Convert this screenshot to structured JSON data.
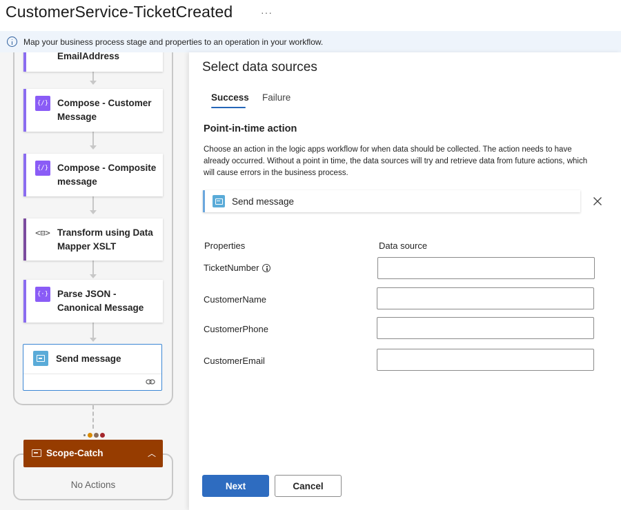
{
  "header": {
    "title": "CustomerService-TicketCreated",
    "more": "···"
  },
  "infobar": {
    "text": "Map your business process stage and properties to an operation in your workflow."
  },
  "canvas": {
    "nodes": [
      {
        "label": "EmailAddress"
      },
      {
        "label": "Compose - Customer Message",
        "icon": "{/}"
      },
      {
        "label": "Compose - Composite message",
        "icon": "{/}"
      },
      {
        "label": "Transform using Data Mapper XSLT",
        "icon": "<⊟>"
      },
      {
        "label": "Parse JSON - Canonical Message",
        "icon": "{⋅}"
      }
    ],
    "selected_node": {
      "label": "Send message"
    },
    "catch": {
      "label": "Scope-Catch",
      "chevron": "︿",
      "empty_text": "No Actions"
    },
    "status_colors": [
      "#d98a00",
      "#8a6c5a",
      "#a4262c"
    ]
  },
  "panel": {
    "title": "Select data sources",
    "tabs": [
      {
        "label": "Success",
        "selected": true
      },
      {
        "label": "Failure",
        "selected": false
      }
    ],
    "section_title": "Point-in-time action",
    "description": "Choose an action in the logic apps workflow for when data should be collected. The action needs to have already occurred. Without a point in time, the data sources will try and retrieve data from future actions, which will cause errors in the business process.",
    "action": {
      "label": "Send message",
      "icon": "send-message-icon"
    },
    "columns": {
      "properties": "Properties",
      "data_source": "Data source"
    },
    "properties": [
      {
        "name": "TicketNumber",
        "value": "",
        "has_info": true
      },
      {
        "name": "CustomerName",
        "value": ""
      },
      {
        "name": "CustomerPhone",
        "value": ""
      },
      {
        "name": "CustomerEmail",
        "value": ""
      }
    ],
    "buttons": {
      "next": "Next",
      "cancel": "Cancel"
    }
  },
  "colors": {
    "accent": "#2e6cc0",
    "compose_icon": "#8a5cf6",
    "servicebus_icon": "#5aabd8",
    "catch_bar": "#963c00"
  }
}
